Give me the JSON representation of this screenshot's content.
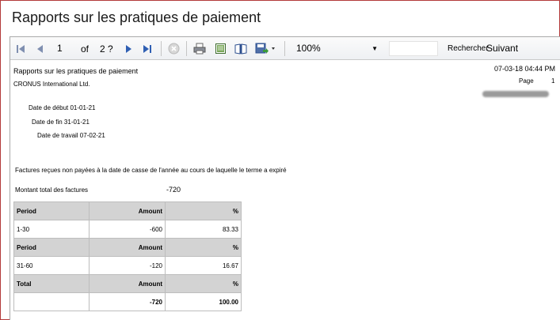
{
  "window": {
    "title": "Rapports sur les pratiques de paiement"
  },
  "toolbar": {
    "page_value": "1",
    "of_label": "of",
    "total_pages": "2 ?",
    "zoom": "100%",
    "search_placeholder": "",
    "search_label": "Rechercher",
    "next_label": "Suivant",
    "icons": [
      "first-page-icon",
      "previous-page-icon",
      "next-page-icon",
      "last-page-icon",
      "stop-icon",
      "print-icon",
      "print-layout-icon",
      "page-setup-icon",
      "export-icon"
    ]
  },
  "report": {
    "title": "Rapports sur les pratiques de paiement",
    "company": "CRONUS International Ltd.",
    "datetime": "07-03-18 04:44 PM",
    "page_label": "Page",
    "page_number": "1",
    "start_date": "Date de début 01-01-21",
    "end_date": "Date de fin 31-01-21",
    "work_date": "Date de travail 07-02-21",
    "unpaid_note": "Factures reçues non payées à la date de casse de l'année au cours de laquelle le terme a expiré",
    "total_label": "Montant total des factures",
    "total_value": "-720",
    "table": {
      "rows": [
        {
          "type": "head",
          "cells": [
            "Period",
            "Amount",
            "%"
          ]
        },
        {
          "type": "body",
          "cells": [
            "1-30",
            "-600",
            "83.33"
          ]
        },
        {
          "type": "head",
          "cells": [
            "Period",
            "Amount",
            "%"
          ]
        },
        {
          "type": "body",
          "cells": [
            "31-60",
            "-120",
            "16.67"
          ]
        },
        {
          "type": "head",
          "cells": [
            "Total",
            "Amount",
            "%"
          ]
        },
        {
          "type": "foot",
          "cells": [
            "",
            "-720",
            "100.00"
          ]
        }
      ]
    }
  }
}
